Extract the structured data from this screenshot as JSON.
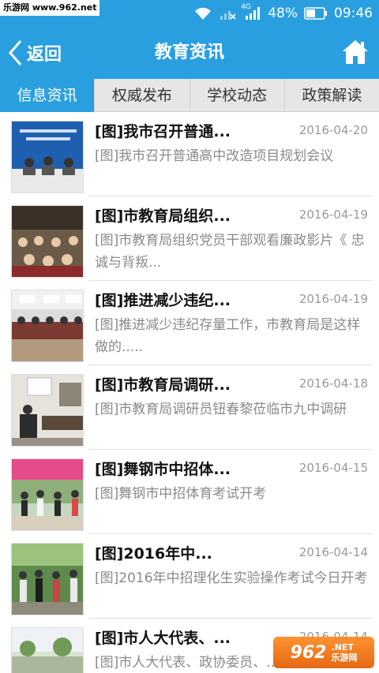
{
  "status_bar": {
    "watermark": "乐游网 www.962.net",
    "network_type": "4G",
    "battery": "48%",
    "time": "09:46",
    "icons": [
      "wifi-icon",
      "no-signal-icon",
      "signal-icon",
      "battery-icon"
    ]
  },
  "nav": {
    "back_label": "返回",
    "title": "教育资讯",
    "home_icon": "home-icon"
  },
  "tabs": [
    {
      "label": "信息资讯",
      "active": true
    },
    {
      "label": "权威发布",
      "active": false
    },
    {
      "label": "学校动态",
      "active": false
    },
    {
      "label": "政策解读",
      "active": false
    }
  ],
  "news": [
    {
      "title": "[图]我市召开普通...",
      "date": "2016-04-20",
      "summary": "[图]我市召开普通高中改造项目规划会议"
    },
    {
      "title": "[图]市教育局组织...",
      "date": "2016-04-19",
      "summary": "[图]市教育局组织党员干部观看廉政影片《 忠诚与背叛..."
    },
    {
      "title": "[图]推进减少违纪...",
      "date": "2016-04-19",
      "summary": "[图]推进减少违纪存量工作，市教育局是这样做的....."
    },
    {
      "title": "[图]市教育局调研...",
      "date": "2016-04-18",
      "summary": "[图]市教育局调研员钮春黎莅临市九中调研"
    },
    {
      "title": "[图]舞钢市中招体...",
      "date": "2016-04-15",
      "summary": "[图]舞钢市中招体育考试开考"
    },
    {
      "title": "[图]2016年中...",
      "date": "2016-04-14",
      "summary": "[图]2016年中招理化生实验操作考试今日开考"
    },
    {
      "title": "[图]市人大代表、...",
      "date": "2016-04-14",
      "summary": "[图]市人大代表、政协委员、..."
    }
  ],
  "watermark_bottom": {
    "logo": "962",
    "site": ".NET",
    "name": "乐游网"
  },
  "colors": {
    "accent": "#2a9fdf",
    "tab_bg": "#e6e6e6",
    "date_text": "#999999",
    "summary_text": "#8a8a8a"
  }
}
